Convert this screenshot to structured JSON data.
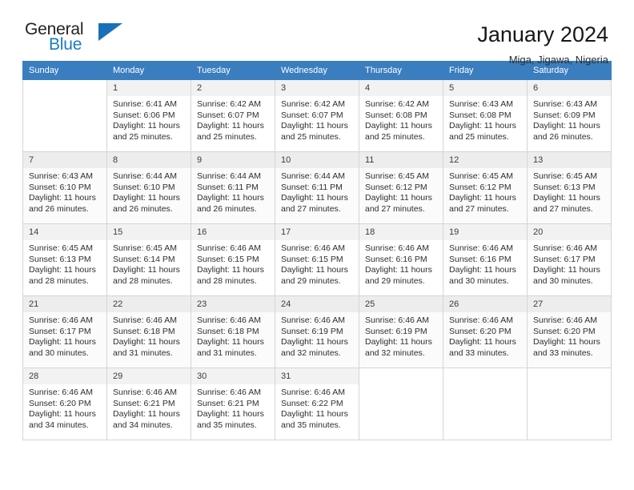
{
  "brand": {
    "name_part1": "General",
    "name_part2": "Blue",
    "accent_color": "#1a7ac4",
    "triangle_icon": "triangle-icon"
  },
  "header": {
    "title": "January 2024",
    "location": "Miga, Jigawa, Nigeria"
  },
  "calendar": {
    "header_bg": "#3a7ebf",
    "weekdays": [
      "Sunday",
      "Monday",
      "Tuesday",
      "Wednesday",
      "Thursday",
      "Friday",
      "Saturday"
    ],
    "weeks": [
      [
        {
          "day": "",
          "sunrise": "",
          "sunset": "",
          "daylight_line1": "",
          "daylight_line2": ""
        },
        {
          "day": "1",
          "sunrise": "Sunrise: 6:41 AM",
          "sunset": "Sunset: 6:06 PM",
          "daylight_line1": "Daylight: 11 hours",
          "daylight_line2": "and 25 minutes."
        },
        {
          "day": "2",
          "sunrise": "Sunrise: 6:42 AM",
          "sunset": "Sunset: 6:07 PM",
          "daylight_line1": "Daylight: 11 hours",
          "daylight_line2": "and 25 minutes."
        },
        {
          "day": "3",
          "sunrise": "Sunrise: 6:42 AM",
          "sunset": "Sunset: 6:07 PM",
          "daylight_line1": "Daylight: 11 hours",
          "daylight_line2": "and 25 minutes."
        },
        {
          "day": "4",
          "sunrise": "Sunrise: 6:42 AM",
          "sunset": "Sunset: 6:08 PM",
          "daylight_line1": "Daylight: 11 hours",
          "daylight_line2": "and 25 minutes."
        },
        {
          "day": "5",
          "sunrise": "Sunrise: 6:43 AM",
          "sunset": "Sunset: 6:08 PM",
          "daylight_line1": "Daylight: 11 hours",
          "daylight_line2": "and 25 minutes."
        },
        {
          "day": "6",
          "sunrise": "Sunrise: 6:43 AM",
          "sunset": "Sunset: 6:09 PM",
          "daylight_line1": "Daylight: 11 hours",
          "daylight_line2": "and 26 minutes."
        }
      ],
      [
        {
          "day": "7",
          "sunrise": "Sunrise: 6:43 AM",
          "sunset": "Sunset: 6:10 PM",
          "daylight_line1": "Daylight: 11 hours",
          "daylight_line2": "and 26 minutes."
        },
        {
          "day": "8",
          "sunrise": "Sunrise: 6:44 AM",
          "sunset": "Sunset: 6:10 PM",
          "daylight_line1": "Daylight: 11 hours",
          "daylight_line2": "and 26 minutes."
        },
        {
          "day": "9",
          "sunrise": "Sunrise: 6:44 AM",
          "sunset": "Sunset: 6:11 PM",
          "daylight_line1": "Daylight: 11 hours",
          "daylight_line2": "and 26 minutes."
        },
        {
          "day": "10",
          "sunrise": "Sunrise: 6:44 AM",
          "sunset": "Sunset: 6:11 PM",
          "daylight_line1": "Daylight: 11 hours",
          "daylight_line2": "and 27 minutes."
        },
        {
          "day": "11",
          "sunrise": "Sunrise: 6:45 AM",
          "sunset": "Sunset: 6:12 PM",
          "daylight_line1": "Daylight: 11 hours",
          "daylight_line2": "and 27 minutes."
        },
        {
          "day": "12",
          "sunrise": "Sunrise: 6:45 AM",
          "sunset": "Sunset: 6:12 PM",
          "daylight_line1": "Daylight: 11 hours",
          "daylight_line2": "and 27 minutes."
        },
        {
          "day": "13",
          "sunrise": "Sunrise: 6:45 AM",
          "sunset": "Sunset: 6:13 PM",
          "daylight_line1": "Daylight: 11 hours",
          "daylight_line2": "and 27 minutes."
        }
      ],
      [
        {
          "day": "14",
          "sunrise": "Sunrise: 6:45 AM",
          "sunset": "Sunset: 6:13 PM",
          "daylight_line1": "Daylight: 11 hours",
          "daylight_line2": "and 28 minutes."
        },
        {
          "day": "15",
          "sunrise": "Sunrise: 6:45 AM",
          "sunset": "Sunset: 6:14 PM",
          "daylight_line1": "Daylight: 11 hours",
          "daylight_line2": "and 28 minutes."
        },
        {
          "day": "16",
          "sunrise": "Sunrise: 6:46 AM",
          "sunset": "Sunset: 6:15 PM",
          "daylight_line1": "Daylight: 11 hours",
          "daylight_line2": "and 28 minutes."
        },
        {
          "day": "17",
          "sunrise": "Sunrise: 6:46 AM",
          "sunset": "Sunset: 6:15 PM",
          "daylight_line1": "Daylight: 11 hours",
          "daylight_line2": "and 29 minutes."
        },
        {
          "day": "18",
          "sunrise": "Sunrise: 6:46 AM",
          "sunset": "Sunset: 6:16 PM",
          "daylight_line1": "Daylight: 11 hours",
          "daylight_line2": "and 29 minutes."
        },
        {
          "day": "19",
          "sunrise": "Sunrise: 6:46 AM",
          "sunset": "Sunset: 6:16 PM",
          "daylight_line1": "Daylight: 11 hours",
          "daylight_line2": "and 30 minutes."
        },
        {
          "day": "20",
          "sunrise": "Sunrise: 6:46 AM",
          "sunset": "Sunset: 6:17 PM",
          "daylight_line1": "Daylight: 11 hours",
          "daylight_line2": "and 30 minutes."
        }
      ],
      [
        {
          "day": "21",
          "sunrise": "Sunrise: 6:46 AM",
          "sunset": "Sunset: 6:17 PM",
          "daylight_line1": "Daylight: 11 hours",
          "daylight_line2": "and 30 minutes."
        },
        {
          "day": "22",
          "sunrise": "Sunrise: 6:46 AM",
          "sunset": "Sunset: 6:18 PM",
          "daylight_line1": "Daylight: 11 hours",
          "daylight_line2": "and 31 minutes."
        },
        {
          "day": "23",
          "sunrise": "Sunrise: 6:46 AM",
          "sunset": "Sunset: 6:18 PM",
          "daylight_line1": "Daylight: 11 hours",
          "daylight_line2": "and 31 minutes."
        },
        {
          "day": "24",
          "sunrise": "Sunrise: 6:46 AM",
          "sunset": "Sunset: 6:19 PM",
          "daylight_line1": "Daylight: 11 hours",
          "daylight_line2": "and 32 minutes."
        },
        {
          "day": "25",
          "sunrise": "Sunrise: 6:46 AM",
          "sunset": "Sunset: 6:19 PM",
          "daylight_line1": "Daylight: 11 hours",
          "daylight_line2": "and 32 minutes."
        },
        {
          "day": "26",
          "sunrise": "Sunrise: 6:46 AM",
          "sunset": "Sunset: 6:20 PM",
          "daylight_line1": "Daylight: 11 hours",
          "daylight_line2": "and 33 minutes."
        },
        {
          "day": "27",
          "sunrise": "Sunrise: 6:46 AM",
          "sunset": "Sunset: 6:20 PM",
          "daylight_line1": "Daylight: 11 hours",
          "daylight_line2": "and 33 minutes."
        }
      ],
      [
        {
          "day": "28",
          "sunrise": "Sunrise: 6:46 AM",
          "sunset": "Sunset: 6:20 PM",
          "daylight_line1": "Daylight: 11 hours",
          "daylight_line2": "and 34 minutes."
        },
        {
          "day": "29",
          "sunrise": "Sunrise: 6:46 AM",
          "sunset": "Sunset: 6:21 PM",
          "daylight_line1": "Daylight: 11 hours",
          "daylight_line2": "and 34 minutes."
        },
        {
          "day": "30",
          "sunrise": "Sunrise: 6:46 AM",
          "sunset": "Sunset: 6:21 PM",
          "daylight_line1": "Daylight: 11 hours",
          "daylight_line2": "and 35 minutes."
        },
        {
          "day": "31",
          "sunrise": "Sunrise: 6:46 AM",
          "sunset": "Sunset: 6:22 PM",
          "daylight_line1": "Daylight: 11 hours",
          "daylight_line2": "and 35 minutes."
        },
        {
          "day": "",
          "sunrise": "",
          "sunset": "",
          "daylight_line1": "",
          "daylight_line2": ""
        },
        {
          "day": "",
          "sunrise": "",
          "sunset": "",
          "daylight_line1": "",
          "daylight_line2": ""
        },
        {
          "day": "",
          "sunrise": "",
          "sunset": "",
          "daylight_line1": "",
          "daylight_line2": ""
        }
      ]
    ]
  }
}
